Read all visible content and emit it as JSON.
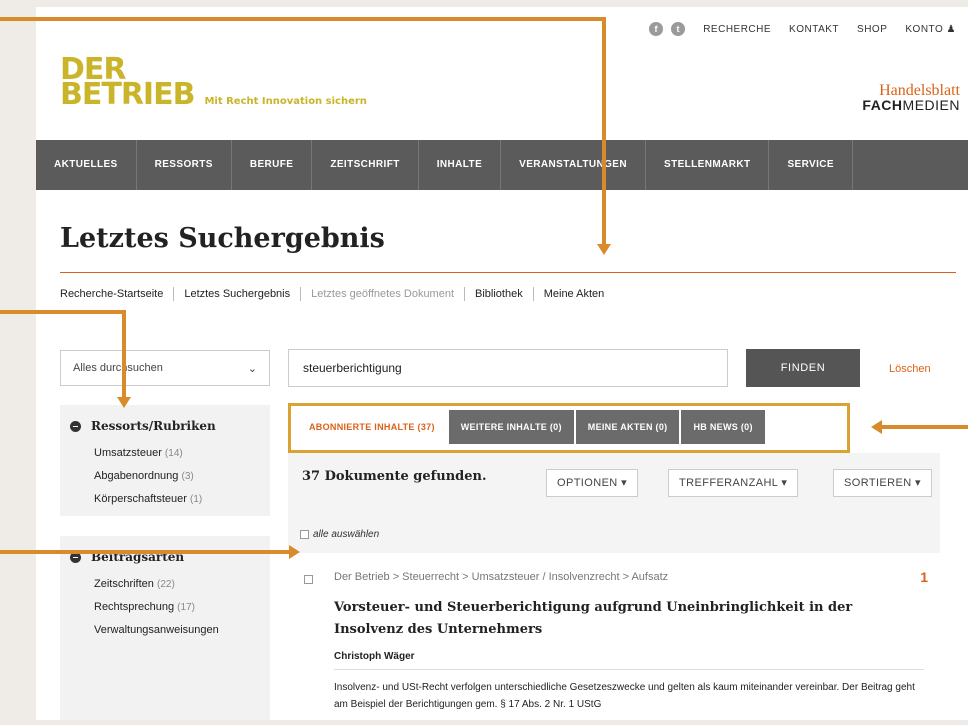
{
  "utility": {
    "social": [
      "f",
      "t"
    ],
    "links": [
      "RECHERCHE",
      "KONTAKT",
      "SHOP",
      "KONTO ♟"
    ]
  },
  "logo": {
    "line1": "DER",
    "line2": "BETRIEB",
    "tagline": "Mit Recht Innovation sichern"
  },
  "partner": {
    "line1": "Handelsblatt",
    "line2_bold": "FACH",
    "line2_rest": "MEDIEN"
  },
  "nav": [
    "AKTUELLES",
    "RESSORTS",
    "BERUFE",
    "ZEITSCHRIFT",
    "INHALTE",
    "VERANSTALTUNGEN",
    "STELLENMARKT",
    "SERVICE"
  ],
  "page_title": "Letztes Suchergebnis",
  "breadcrumb": [
    "Recherche-Startseite",
    "Letztes Suchergebnis",
    "Letztes geöffnetes Dokument",
    "Bibliothek",
    "Meine Akten"
  ],
  "search": {
    "scope_label": "Alles durchsuchen",
    "query": "steuerberichtigung",
    "find_label": "FINDEN",
    "clear_label": "Löschen"
  },
  "facets": [
    {
      "title": "Ressorts/Rubriken",
      "items": [
        {
          "label": "Umsatzsteuer",
          "count": "(14)"
        },
        {
          "label": "Abgabenordnung",
          "count": "(3)"
        },
        {
          "label": "Körperschaftsteuer",
          "count": "(1)"
        }
      ]
    },
    {
      "title": "Beitragsarten",
      "items": [
        {
          "label": "Zeitschriften",
          "count": "(22)"
        },
        {
          "label": "Rechtsprechung",
          "count": "(17)"
        },
        {
          "label": "Verwaltungsanweisungen",
          "count": ""
        }
      ]
    }
  ],
  "tabs": [
    "ABONNIERTE INHALTE (37)",
    "WEITERE INHALTE (0)",
    "MEINE AKTEN (0)",
    "HB NEWS (0)"
  ],
  "results": {
    "count_label": "37 Dokumente gefunden.",
    "options_label": "OPTIONEN ▾",
    "hits_label": "TREFFERANZAHL ▾",
    "sort_label": "SORTIEREN ▾",
    "select_all": "alle auswählen"
  },
  "hit": {
    "path": "Der Betrieb > Steuerrecht > Umsatzsteuer / Insolvenzrecht > Aufsatz",
    "number": "1",
    "title": "Vorsteuer- und Steuerberichtigung aufgrund Uneinbringlichkeit in der Insolvenz des Unternehmers",
    "author": "Christoph Wäger",
    "snippet": "Insolvenz- und USt-Recht verfolgen unterschiedliche Gesetzeszwecke und gelten als kaum miteinander vereinbar. Der Beitrag geht am Beispiel der Berichtigungen gem. § 17 Abs. 2 Nr. 1 UStG"
  },
  "colors": {
    "accent": "#d9621a",
    "annotation": "#d98a2b",
    "logo": "#c9b42a",
    "nav": "#5b5b5b"
  }
}
